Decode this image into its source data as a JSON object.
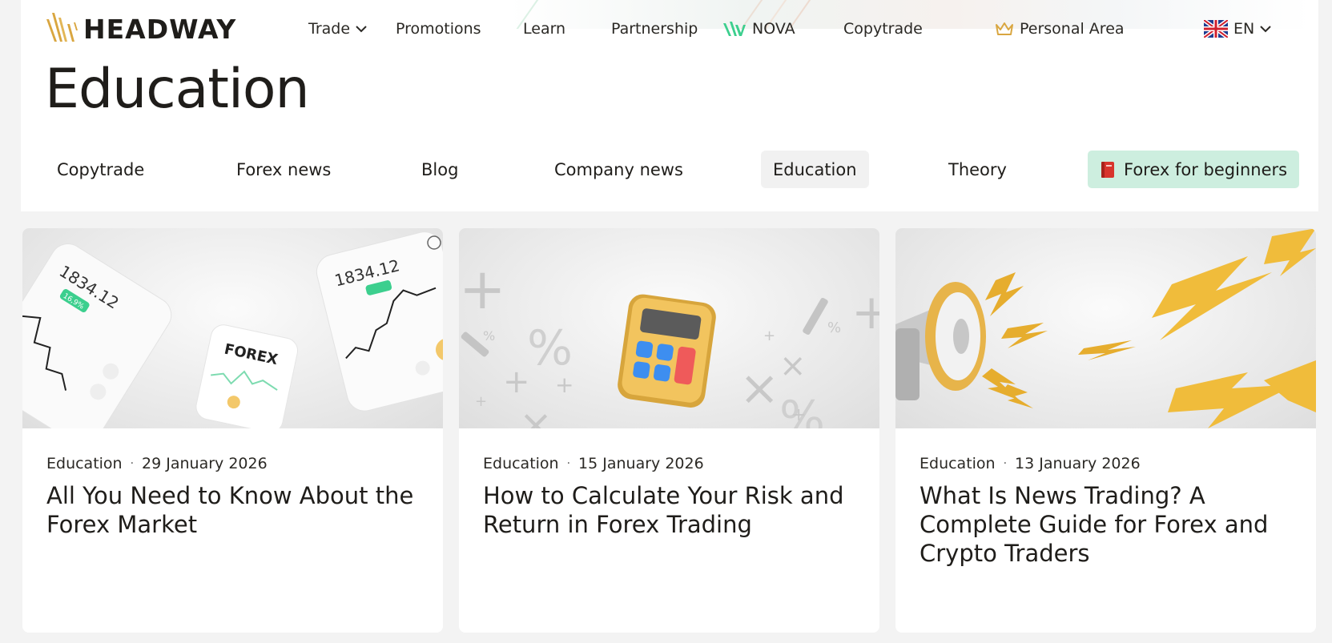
{
  "brand": {
    "logo_text": "HEADWAY",
    "accent": "#d9a640",
    "promo_bg": "#cdeedf",
    "nova_green": "#3ccf8e"
  },
  "nav": {
    "items": [
      {
        "label": "Trade",
        "icon": "chevron-down-icon"
      },
      {
        "label": "Promotions"
      },
      {
        "label": "Learn"
      },
      {
        "label": "Partnership"
      },
      {
        "label": "NOVA",
        "icon": "nova-logo-icon"
      },
      {
        "label": "Copytrade"
      }
    ],
    "personal_area": {
      "label": "Personal Area",
      "icon": "crown-icon"
    },
    "language": {
      "label": "EN",
      "icon": "uk-flag-icon"
    }
  },
  "page": {
    "title": "Education"
  },
  "tabs": [
    {
      "label": "Copytrade"
    },
    {
      "label": "Forex news"
    },
    {
      "label": "Blog"
    },
    {
      "label": "Company news"
    },
    {
      "label": "Education",
      "active": true
    },
    {
      "label": "Theory"
    },
    {
      "label": "Forex for beginners",
      "icon": "book-icon"
    }
  ],
  "cards": [
    {
      "category": "Education",
      "date": "29 January 2026",
      "title": "All You Need to Know About the Forex Market",
      "image_text": {
        "price": "1834.12",
        "price_b": "1834.12",
        "badge": "16,9%",
        "label": "FOREX"
      }
    },
    {
      "category": "Education",
      "date": "15 January 2026",
      "title": "How to Calculate Your Risk and Return in Forex Trading"
    },
    {
      "category": "Education",
      "date": "13 January 2026",
      "title": "What Is News Trading? A Complete Guide for Forex and Crypto Traders"
    }
  ]
}
